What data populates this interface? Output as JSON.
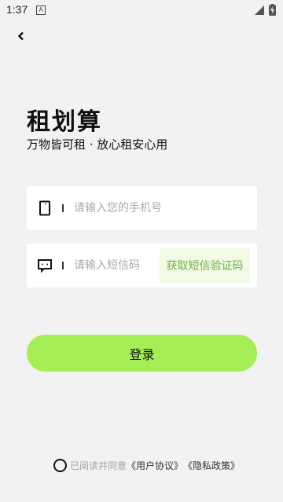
{
  "status_bar": {
    "time": "1:37",
    "app_icon_letter": "A",
    "icons": [
      "signal-icon",
      "battery-charging-icon"
    ]
  },
  "nav": {
    "back_icon": "chevron-left-icon"
  },
  "brand": {
    "logo_text": "租划算",
    "slogan": "万物皆可租 · 放心租安心用"
  },
  "phone_field": {
    "icon": "phone-icon",
    "value": "",
    "placeholder": "请输入您的手机号"
  },
  "code_field": {
    "icon": "message-icon",
    "value": "",
    "placeholder": "请输入短信码",
    "get_code_label": "获取短信验证码"
  },
  "login": {
    "label": "登录"
  },
  "agreement": {
    "text": "已阅读并同意",
    "user_agreement": "《用户协议》",
    "privacy_policy": "《隐私政策》",
    "checked": false
  },
  "colors": {
    "background": "#f2f2f2",
    "accent_green": "#a6ee56",
    "code_button_bg": "#f1fae6",
    "code_button_text": "#6db23b",
    "placeholder": "#a9a9a9"
  }
}
